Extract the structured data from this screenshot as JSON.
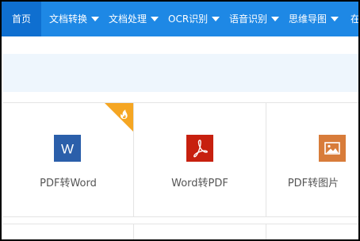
{
  "nav": {
    "home": "首页",
    "items": [
      {
        "label": "文档转换"
      },
      {
        "label": "文档处理"
      },
      {
        "label": "OCR识别"
      },
      {
        "label": "语音识别"
      },
      {
        "label": "思维导图"
      },
      {
        "label": "在"
      }
    ]
  },
  "cards": [
    {
      "label": "PDF转Word",
      "icon": "word-icon",
      "color": "#2b5faa",
      "hot": true
    },
    {
      "label": "Word转PDF",
      "icon": "pdf-icon",
      "color": "#c7200f",
      "hot": false
    },
    {
      "label": "PDF转图片",
      "icon": "image-icon",
      "color": "#d87c3a",
      "hot": false
    }
  ],
  "colors": {
    "nav_bg": "#1e88e5",
    "nav_active": "#0f6fd0",
    "hot_flag": "#f5a623"
  },
  "tile_letter": "W"
}
